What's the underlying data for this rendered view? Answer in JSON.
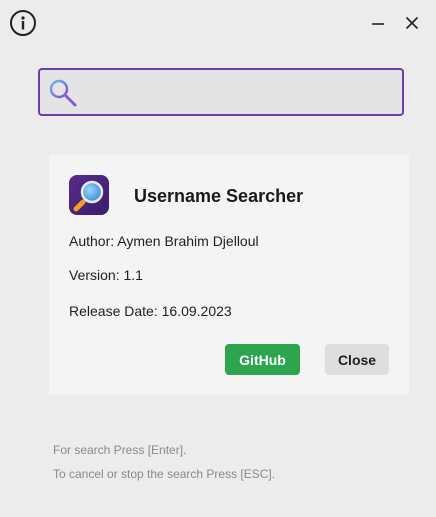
{
  "window": {
    "info_icon": "info-icon",
    "minimize_icon": "minimize-icon",
    "close_icon": "close-icon"
  },
  "search": {
    "icon": "magnifier-icon",
    "value": "",
    "accent_color": "#6b3fa6"
  },
  "about": {
    "app_icon": "magnifier-app-icon",
    "title": "Username Searcher",
    "author": "Author: Aymen Brahim Djelloul",
    "version": "Version: 1.1",
    "release_date": "Release Date: 16.09.2023",
    "github_label": "GitHub",
    "github_color": "#2da44e",
    "close_label": "Close"
  },
  "hints": {
    "search": "For search Press [Enter].",
    "cancel": "To cancel or stop the search Press [ESC]."
  }
}
